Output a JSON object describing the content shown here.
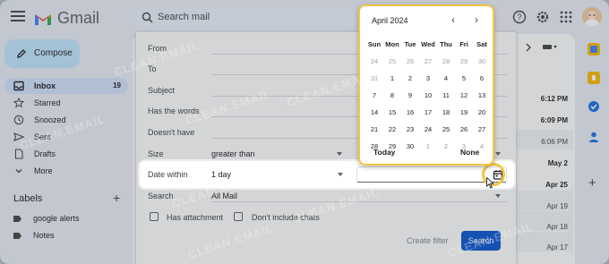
{
  "app": {
    "name": "Gmail"
  },
  "search": {
    "placeholder": "Search mail"
  },
  "sidebar": {
    "compose_label": "Compose",
    "items": [
      {
        "label": "Inbox",
        "count": "19",
        "icon": "inbox-icon"
      },
      {
        "label": "Starred",
        "icon": "star-icon"
      },
      {
        "label": "Snoozed",
        "icon": "clock-icon"
      },
      {
        "label": "Sent",
        "icon": "send-icon"
      },
      {
        "label": "Drafts",
        "icon": "draft-icon"
      },
      {
        "label": "More",
        "icon": "chevron-down-icon"
      }
    ],
    "labels_heading": "Labels",
    "labels": [
      {
        "label": "google alerts"
      },
      {
        "label": "Notes"
      }
    ]
  },
  "advanced_search": {
    "fields": [
      {
        "label": "From"
      },
      {
        "label": "To"
      },
      {
        "label": "Subject"
      },
      {
        "label": "Has the words"
      },
      {
        "label": "Doesn't have"
      },
      {
        "label": "Size",
        "value": "greater than"
      },
      {
        "label": "Date within",
        "value": "1 day"
      },
      {
        "label": "Search",
        "value": "All Mail"
      }
    ],
    "checkboxes": [
      {
        "label": "Has attachment",
        "checked": false
      },
      {
        "label": "Don't include chats",
        "checked": false
      }
    ],
    "create_filter_label": "Create filter",
    "search_button_label": "Search"
  },
  "calendar": {
    "month_label": "April 2024",
    "weekdays": [
      "Sun",
      "Mon",
      "Tue",
      "Wed",
      "Thu",
      "Fri",
      "Sat"
    ],
    "weeks": [
      [
        "24",
        "25",
        "26",
        "27",
        "28",
        "29",
        "30"
      ],
      [
        "31",
        "1",
        "2",
        "3",
        "4",
        "5",
        "6"
      ],
      [
        "7",
        "8",
        "9",
        "10",
        "11",
        "12",
        "13"
      ],
      [
        "14",
        "15",
        "16",
        "17",
        "18",
        "19",
        "20"
      ],
      [
        "21",
        "22",
        "23",
        "24",
        "25",
        "26",
        "27"
      ],
      [
        "28",
        "29",
        "30",
        "1",
        "2",
        "3",
        "4"
      ]
    ],
    "today_label": "Today",
    "none_label": "None"
  },
  "mail_dates": [
    {
      "text": "6:12 PM",
      "bold": true
    },
    {
      "text": "6:09 PM",
      "bold": true
    },
    {
      "text": "6:06 PM",
      "bold": false
    },
    {
      "text": "May 2",
      "bold": true
    },
    {
      "text": "Apr 25",
      "bold": true
    },
    {
      "text": "Apr 19",
      "bold": false
    },
    {
      "text": "Apr 18",
      "bold": false
    },
    {
      "text": "Apr 17",
      "bold": false
    }
  ],
  "colors": {
    "accent": "#0b57d0",
    "highlight_ring": "#f4c542",
    "compose_bg": "#c2e7ff",
    "inbox_active_bg": "#d3e3fd"
  },
  "watermark": "CLEAN.EMAIL"
}
